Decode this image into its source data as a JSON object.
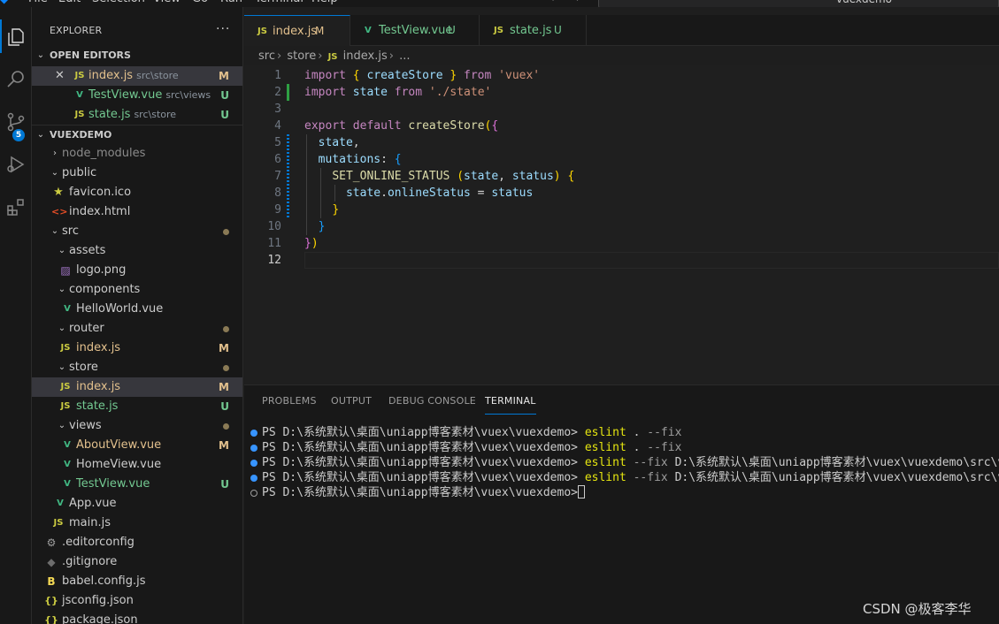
{
  "menubar": {
    "items": [
      "File",
      "Edit",
      "Selection",
      "View",
      "Go",
      "Run",
      "Terminal",
      "Help"
    ],
    "search_text": "vuexdemo"
  },
  "activity": {
    "source_control_badge": "5"
  },
  "sidebar": {
    "title": "EXPLORER",
    "more": "···",
    "open_editors_title": "OPEN EDITORS",
    "open_editors": [
      {
        "icon": "JS",
        "name": "index.js",
        "path": "src\\store",
        "status": "M"
      },
      {
        "icon": "V",
        "name": "TestView.vue",
        "path": "src\\views",
        "status": "U"
      },
      {
        "icon": "JS",
        "name": "state.js",
        "path": "src\\store",
        "status": "U"
      }
    ],
    "project_title": "VUEXDEMO",
    "tree": [
      {
        "name": "node_modules",
        "status": ""
      },
      {
        "name": "public",
        "status": ""
      },
      {
        "name": "favicon.ico",
        "status": ""
      },
      {
        "name": "index.html",
        "status": ""
      },
      {
        "name": "src",
        "status": ""
      },
      {
        "name": "assets",
        "status": ""
      },
      {
        "name": "logo.png",
        "status": ""
      },
      {
        "name": "components",
        "status": ""
      },
      {
        "name": "HelloWorld.vue",
        "status": ""
      },
      {
        "name": "router",
        "status": ""
      },
      {
        "name": "index.js",
        "status": "M"
      },
      {
        "name": "store",
        "status": ""
      },
      {
        "name": "index.js",
        "status": "M"
      },
      {
        "name": "state.js",
        "status": "U"
      },
      {
        "name": "views",
        "status": ""
      },
      {
        "name": "AboutView.vue",
        "status": "M"
      },
      {
        "name": "HomeView.vue",
        "status": ""
      },
      {
        "name": "TestView.vue",
        "status": "U"
      },
      {
        "name": "App.vue",
        "status": ""
      },
      {
        "name": "main.js",
        "status": ""
      },
      {
        "name": ".editorconfig",
        "status": ""
      },
      {
        "name": ".gitignore",
        "status": ""
      },
      {
        "name": "babel.config.js",
        "status": ""
      },
      {
        "name": "jsconfig.json",
        "status": ""
      },
      {
        "name": "package.json",
        "status": ""
      }
    ]
  },
  "tabs": [
    {
      "icon": "JS",
      "label": "index.js",
      "status": "M"
    },
    {
      "icon": "V",
      "label": "TestView.vue",
      "status": "U"
    },
    {
      "icon": "JS",
      "label": "state.js",
      "status": "U"
    }
  ],
  "breadcrumb": [
    "src",
    "store",
    "index.js",
    "..."
  ],
  "editor": {
    "line_numbers": [
      "1",
      "2",
      "3",
      "4",
      "5",
      "6",
      "7",
      "8",
      "9",
      "10",
      "11",
      "12"
    ],
    "tokens": {
      "import": "import",
      "from": "from",
      "createStore": "createStore",
      "vuex": "'vuex'",
      "state": "state",
      "state_path": "'./state'",
      "export": "export",
      "default": "default",
      "mutations": "mutations",
      "set_online": "SET_ONLINE_STATUS",
      "status": "status",
      "onlineStatus": "onlineStatus"
    }
  },
  "panel": {
    "tabs": [
      "PROBLEMS",
      "OUTPUT",
      "DEBUG CONSOLE",
      "TERMINAL"
    ],
    "prompt": "PS D:\\系统默认\\桌面\\uniapp博客素材\\vuex\\vuexdemo>",
    "lines": [
      {
        "cmd": "eslint",
        "args": " . ",
        "flag": "--fix",
        "rest": ""
      },
      {
        "cmd": "eslint",
        "args": " . ",
        "flag": "--fix",
        "rest": ""
      },
      {
        "cmd": "eslint",
        "args": " ",
        "flag": "--fix",
        "rest": " D:\\系统默认\\桌面\\uniapp博客素材\\vuex\\vuexdemo\\src\\views\\"
      },
      {
        "cmd": "eslint",
        "args": " ",
        "flag": "--fix",
        "rest": " D:\\系统默认\\桌面\\uniapp博客素材\\vuex\\vuexdemo\\src\\views\\"
      }
    ]
  },
  "watermark": "CSDN @极客李华",
  "colors": {
    "accent": "#0078d4",
    "modified": "#e2c08d",
    "untracked": "#73c991"
  }
}
